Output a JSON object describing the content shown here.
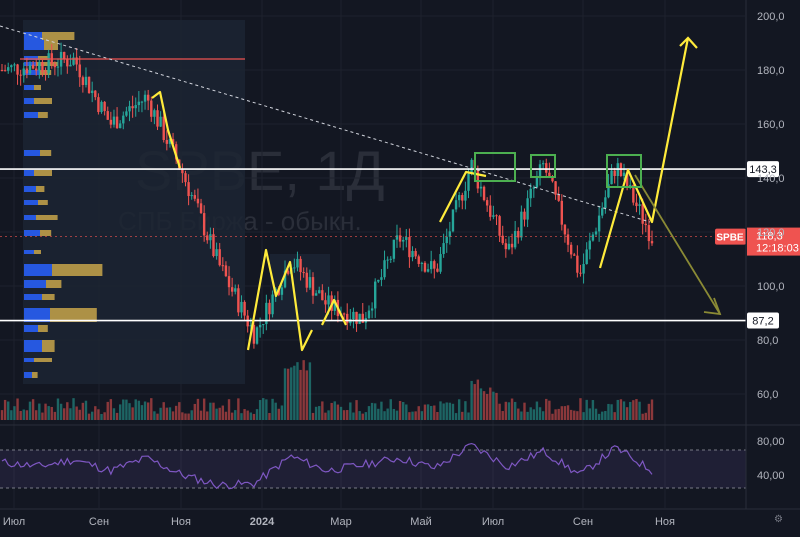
{
  "chart_data": {
    "type": "candlestick",
    "watermark": {
      "symbol": "SPBE, 1Д",
      "description": "СПБ Биржа - обыкн."
    },
    "x_axis": {
      "labels": [
        "Июл",
        "Сен",
        "Ноя",
        "2024",
        "Мар",
        "Май",
        "Июл",
        "Сен",
        "Ноя"
      ]
    },
    "y_axis": {
      "ticks": [
        "200,0",
        "180,0",
        "160,0",
        "140,0",
        "120,0",
        "100,0",
        "80,0",
        "60,0"
      ],
      "ylim": [
        55,
        204
      ]
    },
    "price_series": {
      "name": "SPBE",
      "last_price": "118,3",
      "countdown": "12:18:03",
      "points": [
        {
          "t": "2023-06",
          "v": 180
        },
        {
          "t": "2023-07",
          "v": 182
        },
        {
          "t": "2023-08",
          "v": 184
        },
        {
          "t": "2023-09",
          "v": 160
        },
        {
          "t": "2023-10",
          "v": 170
        },
        {
          "t": "2023-10b",
          "v": 142
        },
        {
          "t": "2023-11",
          "v": 108
        },
        {
          "t": "2023-12",
          "v": 82
        },
        {
          "t": "2024-01",
          "v": 110
        },
        {
          "t": "2024-02",
          "v": 93
        },
        {
          "t": "2024-03",
          "v": 88
        },
        {
          "t": "2024-04",
          "v": 118
        },
        {
          "t": "2024-05",
          "v": 105
        },
        {
          "t": "2024-06",
          "v": 145
        },
        {
          "t": "2024-07",
          "v": 112
        },
        {
          "t": "2024-07b",
          "v": 145
        },
        {
          "t": "2024-08",
          "v": 104
        },
        {
          "t": "2024-09",
          "v": 145
        },
        {
          "t": "2024-10",
          "v": 118.3
        }
      ]
    },
    "levels": [
      {
        "value": 143.3,
        "label": "143,3",
        "color": "#ffffff"
      },
      {
        "value": 87.2,
        "label": "87,2",
        "color": "#ffffff"
      }
    ],
    "rsi": {
      "ticks": [
        "80,00",
        "40,00"
      ],
      "values": [
        55,
        50,
        58,
        45,
        60,
        40,
        28,
        30,
        62,
        45,
        52,
        60,
        48,
        75,
        50,
        68,
        40,
        72,
        45
      ],
      "color": "#7e57c2"
    },
    "colors": {
      "background": "#131722",
      "up": "#26a69a",
      "down": "#ef5350",
      "annotation": "#ffeb3b",
      "box": "#4caf50",
      "resistance_line": "#ef5350"
    }
  }
}
